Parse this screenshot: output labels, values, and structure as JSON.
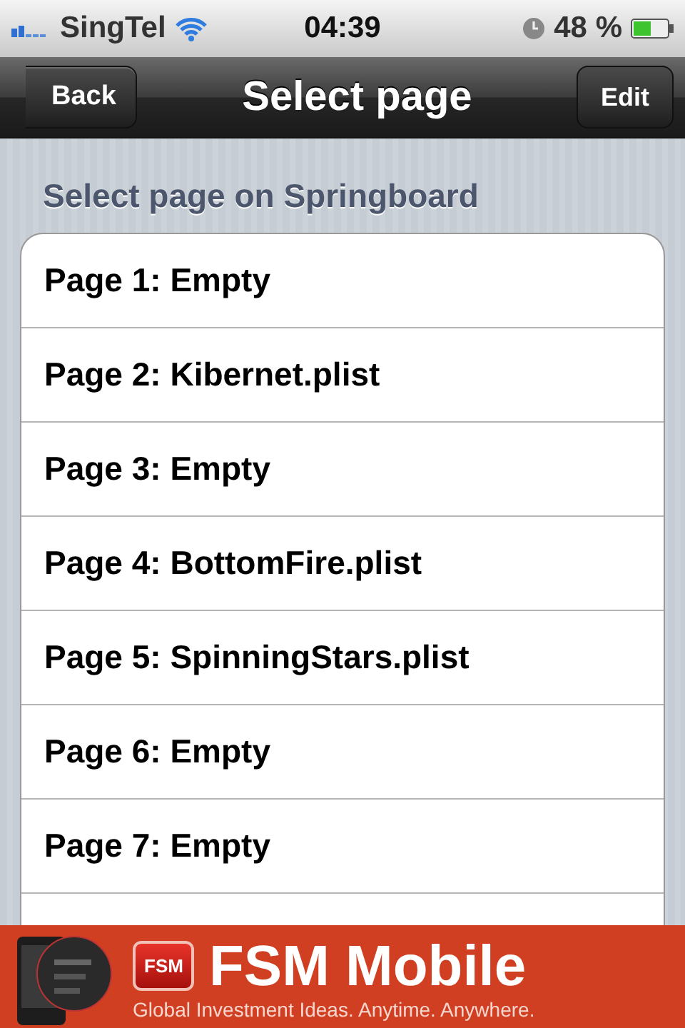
{
  "status_bar": {
    "carrier": "SingTel",
    "time": "04:39",
    "battery": "48 %"
  },
  "nav_bar": {
    "back": "Back",
    "title": "Select page",
    "edit": "Edit"
  },
  "section_header": "Select page on Springboard",
  "pages": [
    {
      "label": "Page 1: Empty"
    },
    {
      "label": "Page 2: Kibernet.plist"
    },
    {
      "label": "Page 3: Empty"
    },
    {
      "label": "Page 4: BottomFire.plist"
    },
    {
      "label": "Page 5: SpinningStars.plist"
    },
    {
      "label": "Page 6: Empty"
    },
    {
      "label": "Page 7: Empty"
    }
  ],
  "ad_banner": {
    "logo": "FSM",
    "title": "FSM Mobile",
    "tagline": "Global Investment Ideas. Anytime. Anywhere."
  }
}
